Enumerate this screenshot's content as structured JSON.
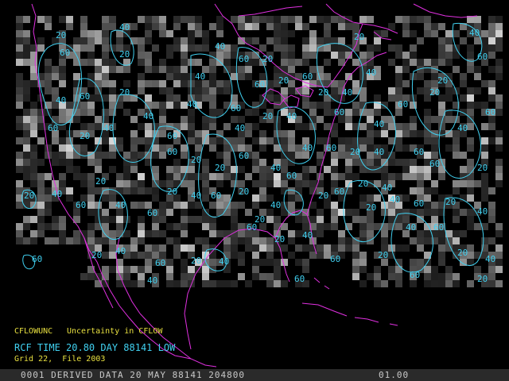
{
  "product": {
    "code": "CFLOWUNC",
    "description": "Uncertainty in CFLOW"
  },
  "time_line": "RCF TIME 20.80 DAY 88141 LOW",
  "grid_line": "Grid 22,  File 2003",
  "status_bar": {
    "text": "0001 DERIVED DATA 20 MAY 88141 204800",
    "frame": "01.00"
  },
  "contour_labels": [
    "20",
    "40",
    "60"
  ],
  "colors": {
    "background": "#000000",
    "contours": "#40d0f0",
    "coastline": "#e030e0",
    "caption": "#e8e040",
    "time_text": "#40d0f0",
    "status_bar": "#2a2a2a"
  }
}
